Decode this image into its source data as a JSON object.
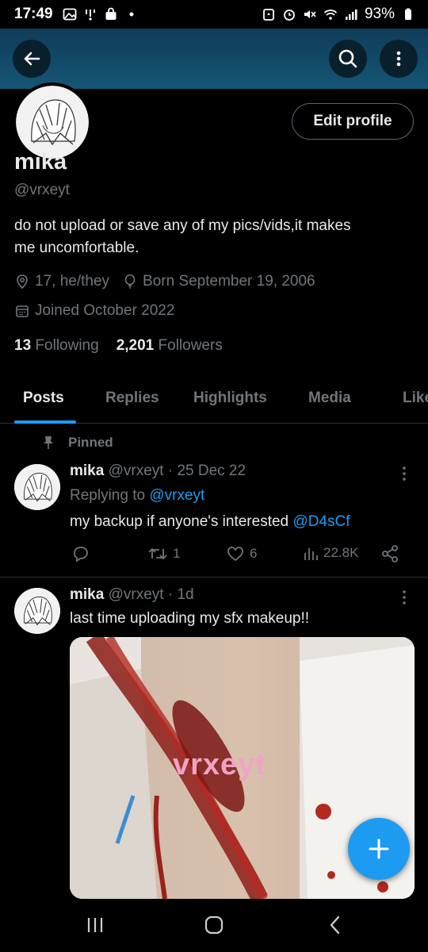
{
  "status_bar": {
    "time": "17:49",
    "battery": "93%",
    "left_icons": [
      "image-icon",
      "hotspot-icon",
      "bag-icon",
      "dot-icon"
    ],
    "right_icons": [
      "battery-saver-icon",
      "alarm-icon",
      "mute-icon",
      "wifi-icon",
      "signal-icon",
      "battery-icon"
    ]
  },
  "header": {
    "back_icon": "arrow-left-icon",
    "search_icon": "search-icon",
    "more_icon": "more-vertical-icon"
  },
  "profile": {
    "edit_label": "Edit profile",
    "name": "mika",
    "handle": "@vrxeyt",
    "bio_line1": "do not upload or save any of my pics/vids,it makes",
    "bio_line2": "me uncomfortable.",
    "location": "17, he/they",
    "birthday": "Born September 19, 2006",
    "joined": "Joined October 2022",
    "following_count": "13",
    "following_label": "Following",
    "followers_count": "2,201",
    "followers_label": "Followers"
  },
  "tabs": [
    {
      "label": "Posts",
      "active": true
    },
    {
      "label": "Replies",
      "active": false
    },
    {
      "label": "Highlights",
      "active": false
    },
    {
      "label": "Media",
      "active": false
    },
    {
      "label": "Likes",
      "active": false
    }
  ],
  "tweets": [
    {
      "pinned_label": "Pinned",
      "name": "mika",
      "handle": "@vrxeyt",
      "sep": "·",
      "time": "25 Dec 22",
      "replying_prefix": "Replying to",
      "replying_to": "@vrxeyt",
      "text": "my backup if anyone's interested",
      "mention": "@D4sCf",
      "replies": "",
      "retweets": "1",
      "likes": "6",
      "views": "22.8K"
    },
    {
      "name": "mika",
      "handle": "@vrxeyt",
      "sep": "·",
      "time": "1d",
      "text": "last time uploading my sfx makeup!!",
      "media_watermark": "vrxeyt"
    }
  ],
  "fab": {
    "icon": "plus-icon"
  },
  "navbar": {
    "recents_icon": "recents-icon",
    "home_icon": "home-icon",
    "back_icon": "nav-back-icon"
  },
  "colors": {
    "accent": "#1d9bf0",
    "muted": "#71767b",
    "text": "#e7e9ea",
    "banner": "#155675"
  }
}
